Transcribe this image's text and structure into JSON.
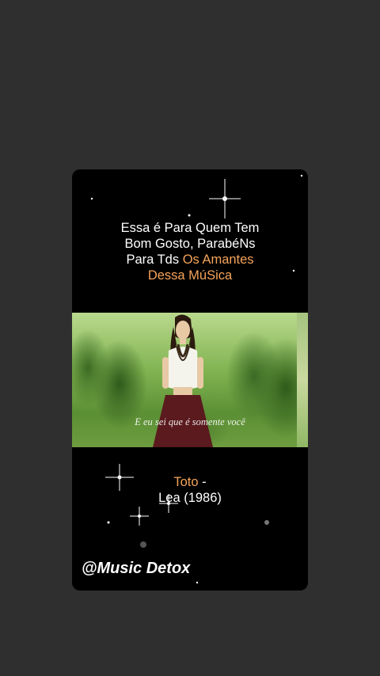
{
  "caption": {
    "line1": "Essa é Para Quem Tem",
    "line2": "Bom Gosto, ParabéNs",
    "line3_white": "Para Tds",
    "line3_accent": "Os Amantes",
    "line4_accent": "Dessa MúSica"
  },
  "video": {
    "subtitle": "E eu sei que é somente você"
  },
  "song": {
    "artist": "Toto",
    "separator": "-",
    "title_year": "Lea (1986)"
  },
  "watermark": {
    "handle": "@Music Detox"
  },
  "colors": {
    "background": "#2f2f2f",
    "card": "#000000",
    "accent": "#f5a45a",
    "text": "#ffffff"
  }
}
